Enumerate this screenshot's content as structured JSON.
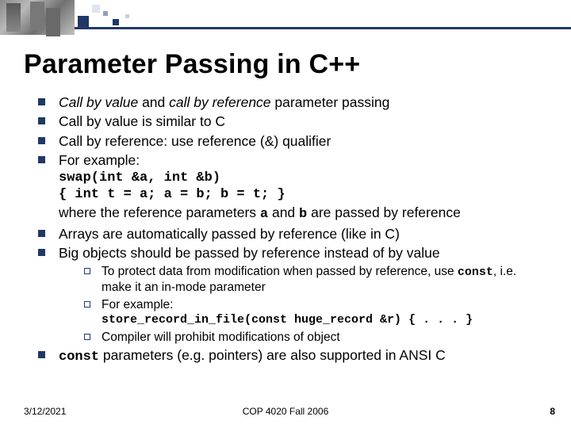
{
  "title": "Parameter Passing in C++",
  "bullets": {
    "b1_pre": "Call by value",
    "b1_mid": " and ",
    "b1_em": "call by reference",
    "b1_post": " parameter passing",
    "b2": "Call by value is similar to C",
    "b3": "Call by reference: use reference (&) qualifier",
    "b4": "For example:",
    "code1": "swap(int &a, int &b)",
    "code2": "{ int t = a; a = b; b = t; }",
    "ref_text_pre": "where the reference parameters ",
    "ref_a": "a",
    "ref_text_mid": " and ",
    "ref_b": "b",
    "ref_text_post": " are passed by reference",
    "b5": "Arrays are automatically passed by reference (like in C)",
    "b6": "Big objects should be passed by reference instead of by value",
    "sub1_pre": "To protect data from modification when passed by reference, use ",
    "sub1_code": "const",
    "sub1_post": ", i.e. make it an in-mode parameter",
    "sub2": "For example:",
    "sub2_code": "store_record_in_file(const huge_record &r) { . . . }",
    "sub3": "Compiler will prohibit modifications of object",
    "b7_code": "const",
    "b7_post": " parameters (e.g. pointers) are also supported in ANSI C"
  },
  "footer": {
    "date": "3/12/2021",
    "center": "COP 4020 Fall 2006",
    "page": "8"
  }
}
